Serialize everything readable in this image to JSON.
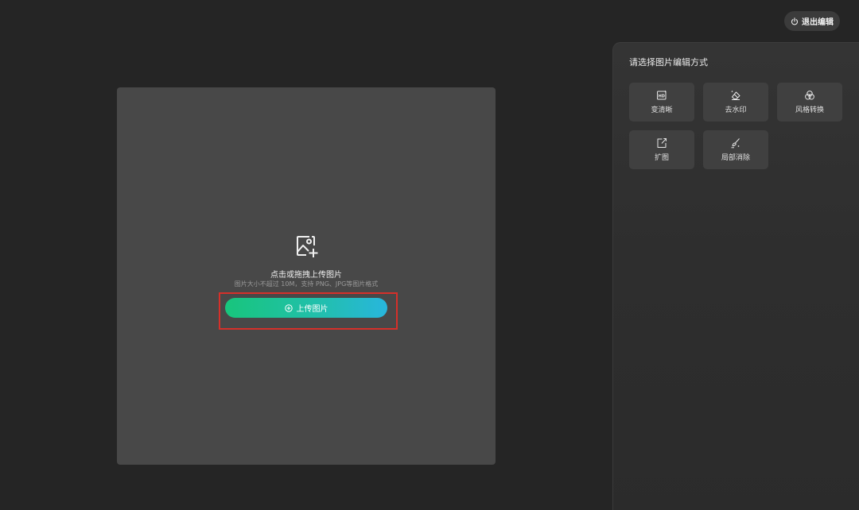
{
  "header": {
    "exit_label": "退出编辑",
    "exit_icon": "power-icon"
  },
  "upload": {
    "icon": "image-add-icon",
    "title": "点击或拖拽上传图片",
    "hint": "图片大小不超过 10M，支持 PNG、JPG等图片格式",
    "button_label": "上传图片",
    "button_icon": "plus-circle-icon",
    "button_gradient": [
      "#18c57c",
      "#28b6dd"
    ],
    "highlight_color": "#d6302a"
  },
  "panel": {
    "title": "请选择图片编辑方式",
    "tools": [
      {
        "label": "变清晰",
        "icon": "hd-icon"
      },
      {
        "label": "去水印",
        "icon": "eraser-icon"
      },
      {
        "label": "风格转换",
        "icon": "style-circles-icon"
      },
      {
        "label": "扩图",
        "icon": "expand-image-icon"
      },
      {
        "label": "局部消除",
        "icon": "brush-erase-icon"
      }
    ]
  }
}
